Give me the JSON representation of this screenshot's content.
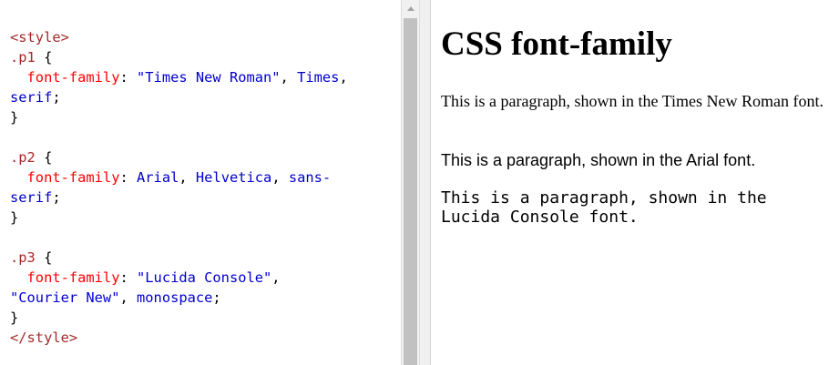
{
  "editor": {
    "lines": [
      [
        {
          "t": "<style>",
          "c": "tag"
        }
      ],
      [
        {
          "t": ".p1",
          "c": "sel"
        },
        {
          "t": " {",
          "c": "punct"
        }
      ],
      [
        {
          "t": "  font-family",
          "c": "prop"
        },
        {
          "t": ": ",
          "c": "punct"
        },
        {
          "t": "\"Times New Roman\"",
          "c": "val"
        },
        {
          "t": ", ",
          "c": "punct"
        },
        {
          "t": "Times",
          "c": "val"
        },
        {
          "t": ",",
          "c": "punct"
        }
      ],
      [
        {
          "t": "serif",
          "c": "val"
        },
        {
          "t": ";",
          "c": "punct"
        }
      ],
      [
        {
          "t": "}",
          "c": "punct"
        }
      ],
      [],
      [
        {
          "t": ".p2",
          "c": "sel"
        },
        {
          "t": " {",
          "c": "punct"
        }
      ],
      [
        {
          "t": "  font-family",
          "c": "prop"
        },
        {
          "t": ": ",
          "c": "punct"
        },
        {
          "t": "Arial",
          "c": "val"
        },
        {
          "t": ", ",
          "c": "punct"
        },
        {
          "t": "Helvetica",
          "c": "val"
        },
        {
          "t": ", ",
          "c": "punct"
        },
        {
          "t": "sans-",
          "c": "val"
        }
      ],
      [
        {
          "t": "serif",
          "c": "val"
        },
        {
          "t": ";",
          "c": "punct"
        }
      ],
      [
        {
          "t": "}",
          "c": "punct"
        }
      ],
      [],
      [
        {
          "t": ".p3",
          "c": "sel"
        },
        {
          "t": " {",
          "c": "punct"
        }
      ],
      [
        {
          "t": "  font-family",
          "c": "prop"
        },
        {
          "t": ": ",
          "c": "punct"
        },
        {
          "t": "\"Lucida Console\"",
          "c": "val"
        },
        {
          "t": ",",
          "c": "punct"
        }
      ],
      [
        {
          "t": "\"Courier New\"",
          "c": "val"
        },
        {
          "t": ", ",
          "c": "punct"
        },
        {
          "t": "monospace",
          "c": "val"
        },
        {
          "t": ";",
          "c": "punct"
        }
      ],
      [
        {
          "t": "}",
          "c": "punct"
        }
      ],
      [
        {
          "t": "</style>",
          "c": "tag"
        }
      ]
    ]
  },
  "preview": {
    "heading": "CSS font-family",
    "p1": "This is a paragraph, shown in the Times New Roman font.",
    "p2": "This is a paragraph, shown in the Arial font.",
    "p3": "This is a paragraph, shown in the Lucida Console font."
  },
  "colors": {
    "tag": "#a52a2a",
    "selector": "#a52a2a",
    "property": "#ff0000",
    "value": "#0000cd",
    "scrollbar_thumb": "#c1c1c1"
  },
  "icons": {
    "scroll_up": "triangle-up-icon"
  }
}
